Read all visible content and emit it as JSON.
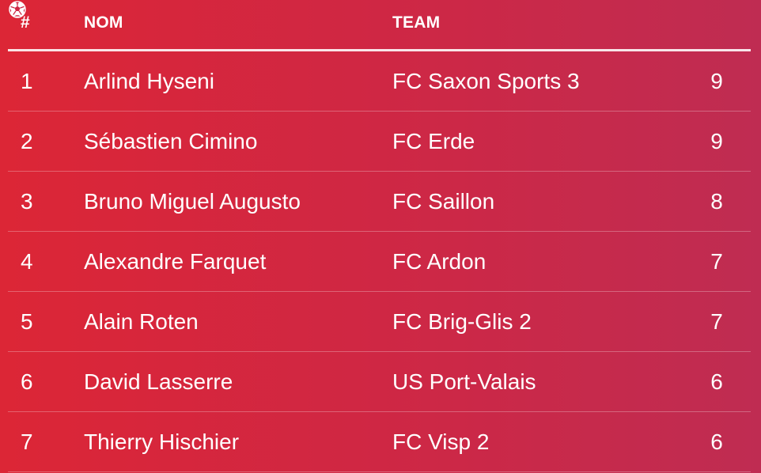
{
  "table": {
    "headers": {
      "rank": "#",
      "name": "NOM",
      "team": "TEAM",
      "goals_icon": "soccer-ball-icon"
    },
    "rows": [
      {
        "rank": "1",
        "name": "Arlind Hyseni",
        "team": "FC Saxon Sports 3",
        "goals": "9"
      },
      {
        "rank": "2",
        "name": "Sébastien Cimino",
        "team": "FC Erde",
        "goals": "9"
      },
      {
        "rank": "3",
        "name": "Bruno Miguel Augusto",
        "team": "FC Saillon",
        "goals": "8"
      },
      {
        "rank": "4",
        "name": "Alexandre Farquet",
        "team": "FC Ardon",
        "goals": "7"
      },
      {
        "rank": "5",
        "name": "Alain Roten",
        "team": "FC Brig-Glis 2",
        "goals": "7"
      },
      {
        "rank": "6",
        "name": "David Lasserre",
        "team": "US Port-Valais",
        "goals": "6"
      },
      {
        "rank": "7",
        "name": "Thierry Hischier",
        "team": "FC Visp 2",
        "goals": "6"
      }
    ]
  },
  "colors": {
    "gradient_left": "#dc2636",
    "gradient_right": "#bf2c52",
    "text": "#ffffff"
  }
}
